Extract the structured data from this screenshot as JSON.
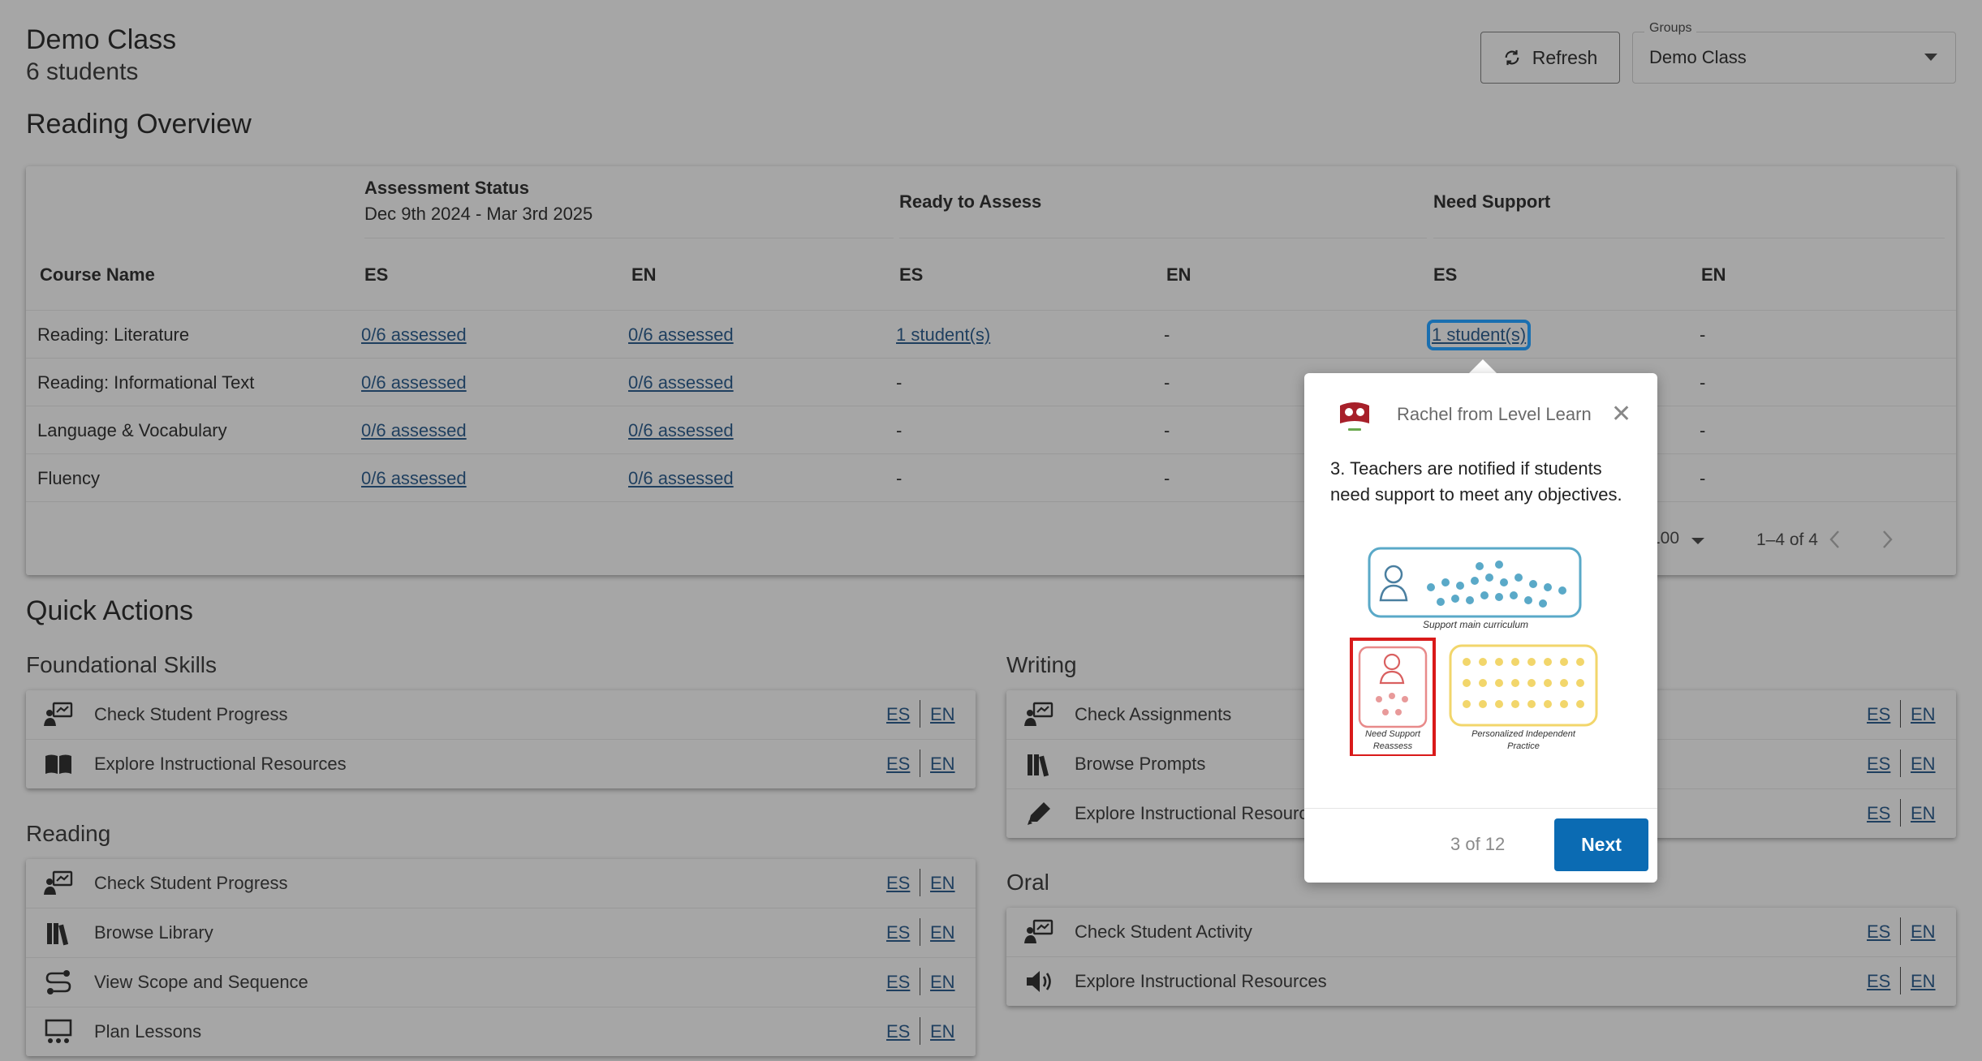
{
  "header": {
    "class_name": "Demo Class",
    "student_count": "6 students",
    "refresh_label": "Refresh",
    "groups_label": "Groups",
    "groups_value": "Demo Class"
  },
  "reading_overview": {
    "title": "Reading Overview",
    "group_headers": {
      "assessment_status": "Assessment Status",
      "assessment_dates": "Dec 9th 2024 - Mar 3rd 2025",
      "ready_to_assess": "Ready to Assess",
      "need_support": "Need Support"
    },
    "columns": [
      "Course Name",
      "ES",
      "EN",
      "ES",
      "EN",
      "ES",
      "EN"
    ],
    "rows": [
      {
        "course": "Reading: Literature",
        "as_es": "0/6 assessed",
        "as_en": "0/6 assessed",
        "rta_es": "1 student(s)",
        "rta_en": "-",
        "ns_es": "1 student(s)",
        "ns_en": "-"
      },
      {
        "course": "Reading: Informational Text",
        "as_es": "0/6 assessed",
        "as_en": "0/6 assessed",
        "rta_es": "-",
        "rta_en": "-",
        "ns_es": "",
        "ns_en": "-"
      },
      {
        "course": "Language & Vocabulary",
        "as_es": "0/6 assessed",
        "as_en": "0/6 assessed",
        "rta_es": "-",
        "rta_en": "-",
        "ns_es": "",
        "ns_en": "-"
      },
      {
        "course": "Fluency",
        "as_es": "0/6 assessed",
        "as_en": "0/6 assessed",
        "rta_es": "-",
        "rta_en": "-",
        "ns_es": "",
        "ns_en": "-"
      }
    ],
    "pagination": {
      "rows_per_page": "100",
      "range": "1–4 of 4"
    }
  },
  "quick_actions": {
    "title": "Quick Actions",
    "lang_es": "ES",
    "lang_en": "EN",
    "foundational": {
      "title": "Foundational Skills",
      "items": [
        {
          "label": "Check Student Progress",
          "icon": "progress-board-icon"
        },
        {
          "label": "Explore Instructional Resources",
          "icon": "open-book-icon"
        }
      ]
    },
    "reading": {
      "title": "Reading",
      "items": [
        {
          "label": "Check Student Progress",
          "icon": "progress-board-icon"
        },
        {
          "label": "Browse Library",
          "icon": "library-books-icon"
        },
        {
          "label": "View Scope and Sequence",
          "icon": "route-icon"
        },
        {
          "label": "Plan Lessons",
          "icon": "presentation-icon"
        }
      ]
    },
    "writing": {
      "title": "Writing",
      "items": [
        {
          "label": "Check Assignments",
          "icon": "progress-board-icon"
        },
        {
          "label": "Browse Prompts",
          "icon": "library-books-icon"
        },
        {
          "label": "Explore Instructional Resources",
          "icon": "pencil-icon"
        }
      ]
    },
    "oral": {
      "title": "Oral",
      "items": [
        {
          "label": "Check Student Activity",
          "icon": "progress-board-icon"
        },
        {
          "label": "Explore Instructional Resources",
          "icon": "speaker-icon"
        }
      ]
    }
  },
  "tooltip": {
    "sender": "Rachel from Level Learn",
    "body": "3. Teachers are notified if students need support to meet any objectives.",
    "image_labels": {
      "main": "Support main curriculum",
      "need_support_1": "Need Support",
      "need_support_2": "Reassess",
      "independent_1": "Personalized Independent",
      "independent_2": "Practice"
    },
    "step": "3 of 12",
    "next_label": "Next"
  },
  "colors": {
    "overlay_bg": "#a6a6a6",
    "link": "#1f3f5f",
    "focus": "#1a6fb0",
    "next_button": "#0b6bb3",
    "illus_blue": "#5aa9c8",
    "illus_red": "#d91a1a",
    "illus_yellow": "#f2d66b"
  }
}
